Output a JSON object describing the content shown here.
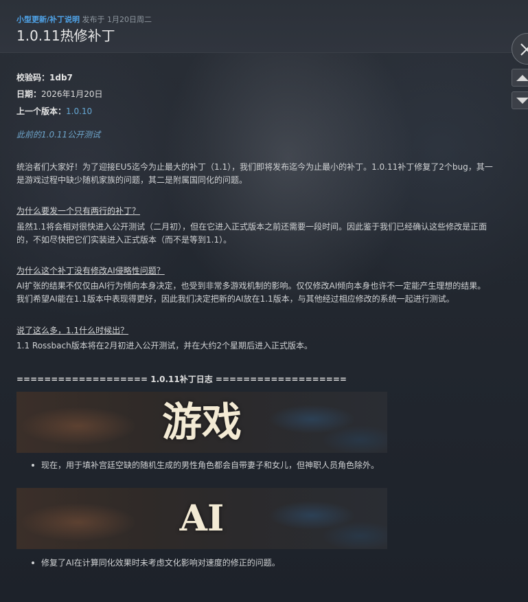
{
  "header": {
    "category": "小型更新/补丁说明",
    "published_prefix": "发布于",
    "date": "1月20日周二",
    "title": "1.0.11热修补丁"
  },
  "meta": {
    "checksum_label": "校验码：",
    "checksum_value": "1db7",
    "date_label": "日期：",
    "date_value": "2026年1月20日",
    "prev_label": "上一个版本：",
    "prev_value": "1.0.10"
  },
  "prev_test_link": "此前的1.0.11公开测试",
  "intro_lines": [
    "统治者们大家好！为了迎接EU5迄今为止最大的补丁（1.1），我们即将发布迄今为止最小的补丁。1.0.11补丁修复了2个bug，其一",
    "是游戏过程中缺少随机家族的问题，其二是附属国同化的问题。"
  ],
  "sections": [
    {
      "heading": "为什么要发一个只有两行的补丁？",
      "lines": [
        "虽然1.1将会相对很快进入公开测试（二月初），但在它进入正式版本之前还需要一段时间。因此鉴于我们已经确认这些修改是正面",
        "的，不如尽快把它们实装进入正式版本（而不是等到1.1）。"
      ]
    },
    {
      "heading": "为什么这个补丁没有修改AI侵略性问题？",
      "lines": [
        "AI扩张的结果不仅仅由AI行为倾向本身决定，也受到非常多游戏机制的影响。仅仅修改AI倾向本身也许不一定能产生理想的结果。",
        "我们希望AI能在1.1版本中表现得更好，因此我们决定把新的AI放在1.1版本，与其他经过相应修改的系统一起进行测试。"
      ]
    },
    {
      "heading": "说了这么多，1.1什么时候出？",
      "lines": [
        "1.1 Rossbach版本将在2月初进入公开测试，并在大约2个星期后进入正式版本。"
      ]
    }
  ],
  "changelog_divider": "=================== 1.0.11补丁日志 ===================",
  "changelog": [
    {
      "banner": "游戏",
      "item": "现在，用于填补宫廷空缺的随机生成的男性角色都会自带妻子和女儿，但神职人员角色除外。"
    },
    {
      "banner": "AI",
      "item": "修复了AI在计算同化效果时未考虑文化影响对速度的修正的问题。"
    }
  ],
  "icons": {
    "close": "close-icon",
    "up": "chevron-up-icon",
    "down": "chevron-down-icon"
  },
  "colors": {
    "accent": "#4fa3e8",
    "link": "#67a9d6",
    "banner_text": "#f3ead4"
  }
}
